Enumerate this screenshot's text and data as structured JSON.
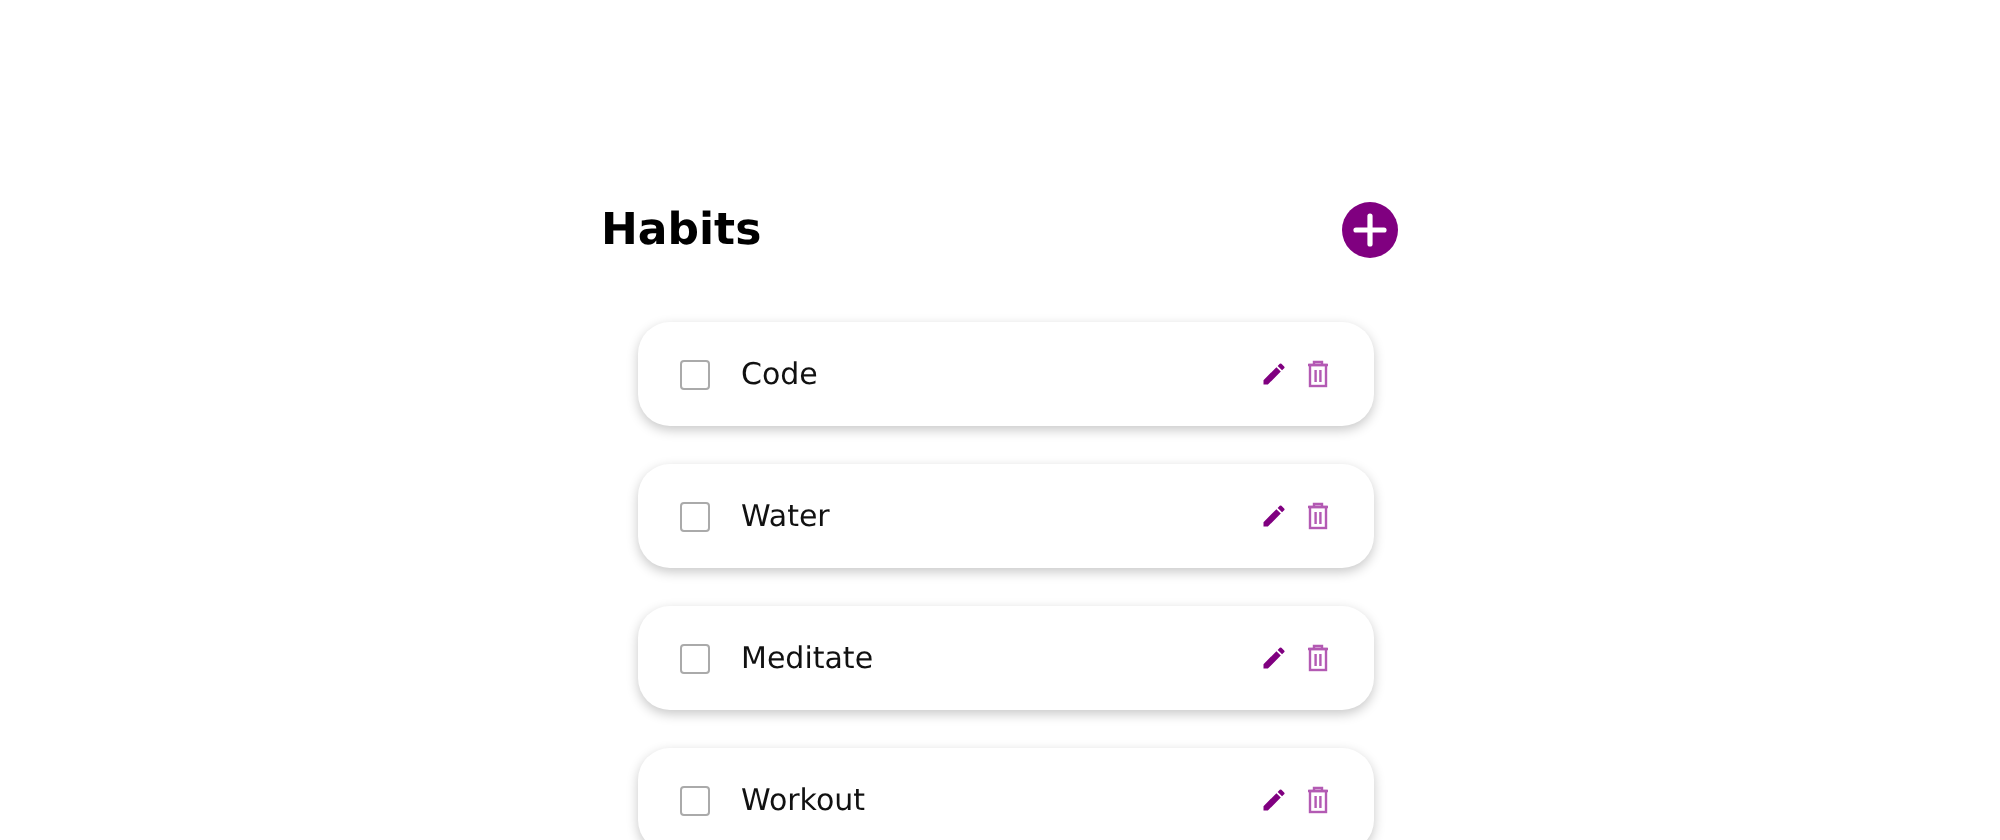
{
  "title": "Habits",
  "habits": [
    {
      "name": "Code",
      "checked": false
    },
    {
      "name": "Water",
      "checked": false
    },
    {
      "name": "Meditate",
      "checked": false
    },
    {
      "name": "Workout",
      "checked": false
    }
  ]
}
